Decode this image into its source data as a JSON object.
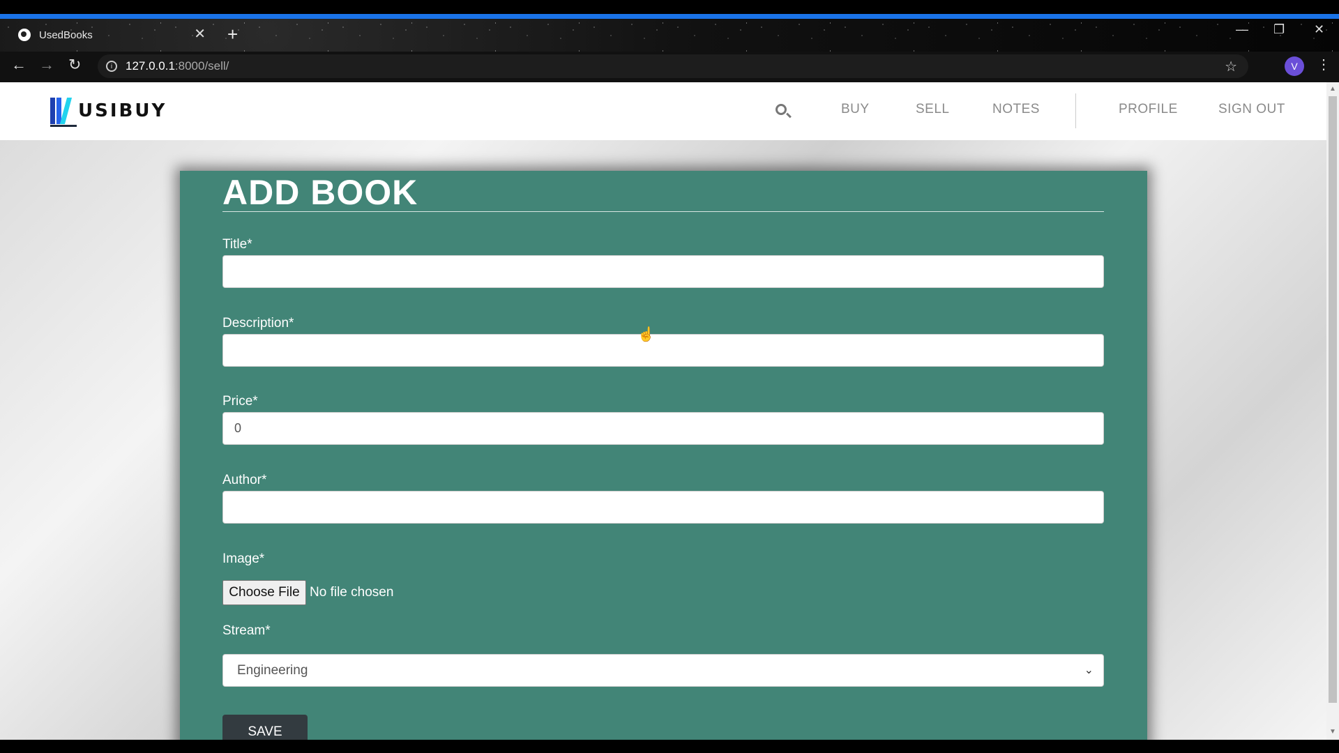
{
  "browser": {
    "tab_title": "UsedBooks",
    "tab_close": "✕",
    "new_tab": "+",
    "url_host": "127.0.0.1",
    "url_rest": ":8000/sell/",
    "avatar_letter": "V",
    "icons": [
      "back-icon",
      "forward-icon",
      "reload-icon",
      "info-icon",
      "bookmark-star-icon",
      "kebab-menu-icon",
      "minimize-icon",
      "restore-icon",
      "close-window-icon"
    ]
  },
  "site": {
    "logo_text": "USIBUY",
    "nav": {
      "buy": "BUY",
      "sell": "SELL",
      "notes": "NOTES",
      "profile": "PROFILE",
      "sign_out": "SIGN OUT"
    }
  },
  "form": {
    "heading": "ADD BOOK",
    "title_label": "Title*",
    "title_value": "",
    "description_label": "Description*",
    "description_value": "",
    "price_label": "Price*",
    "price_value": "0",
    "author_label": "Author*",
    "author_value": "",
    "image_label": "Image*",
    "choose_file": "Choose File",
    "file_status": "No file chosen",
    "stream_label": "Stream*",
    "stream_value": "Engineering",
    "save_label": "SAVE"
  },
  "colors": {
    "panel": "#428577",
    "save_button": "#333b40",
    "browser_accent": "#1a73e8"
  }
}
